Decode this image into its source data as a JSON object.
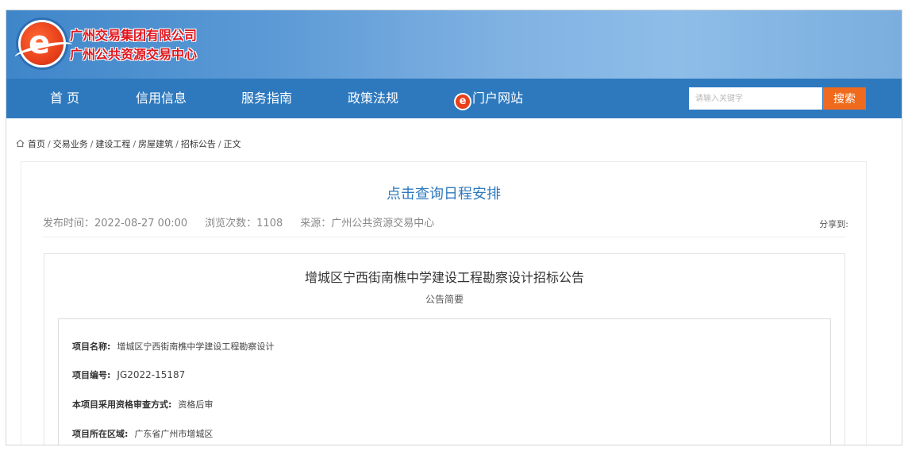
{
  "header": {
    "company_line1": "广州交易集团有限公司",
    "company_line2": "广州公共资源交易中心",
    "brand_color": "#2e79be",
    "logo_color": "#e8401b"
  },
  "nav": {
    "items": [
      {
        "label": "首 页"
      },
      {
        "label": "信用信息"
      },
      {
        "label": "服务指南"
      },
      {
        "label": "政策法规"
      },
      {
        "label": "门户网站",
        "icon": "portal-e-icon"
      }
    ],
    "search_placeholder": "请输入关键字",
    "search_value": "",
    "search_button": "搜索",
    "search_button_color": "#ef6a1c"
  },
  "breadcrumb": [
    "首页",
    "交易业务",
    "建设工程",
    "房屋建筑",
    "招标公告",
    "正文"
  ],
  "article": {
    "title": "点击查询日程安排",
    "publish_time": "发布时间：2022-08-27 00:00",
    "views": "浏览次数：1108",
    "source": "来源：广州公共资源交易中心",
    "share_label": "分享到:"
  },
  "notice": {
    "title": "增城区宁西街南樵中学建设工程勘察设计招标公告",
    "subtitle": "公告简要",
    "fields": [
      {
        "label": "项目名称:",
        "value": "增城区宁西街南樵中学建设工程勘察设计"
      },
      {
        "label": "项目编号:",
        "value": "JG2022-15187"
      },
      {
        "label": "本项目采用资格审查方式:",
        "value": "资格后审"
      },
      {
        "label": "项目所在区域:",
        "value": "广东省广州市增城区"
      }
    ]
  }
}
